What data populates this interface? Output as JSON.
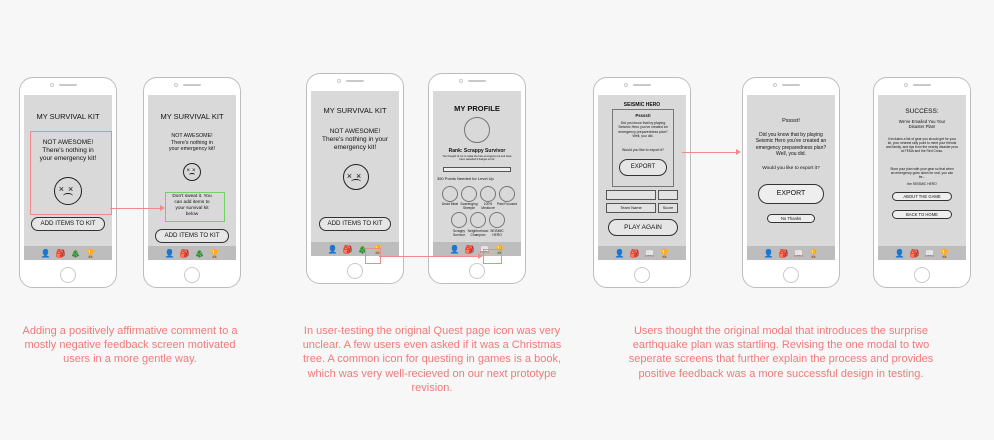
{
  "icons": {
    "person": "person-icon",
    "backpack": "backpack-icon",
    "tree": "tree-icon",
    "book": "book-icon",
    "trophy": "trophy-icon"
  },
  "colors": {
    "highlight_red": "#f08a8a",
    "highlight_green": "#6ed35f",
    "caption": "#ef7a7a",
    "screen": "#d9d9d9"
  },
  "group1": {
    "phone1": {
      "title": "MY SURVIVAL KIT",
      "message": "NOT AWESOME! There's nothing in your emergency kit!",
      "button": "ADD ITEMS TO KIT"
    },
    "phone2": {
      "title": "MY SURVIVAL KIT",
      "message": "NOT AWESOME! There's nothing in your emergency kit!",
      "note": "Don't sweat it. You can add items to your survival kit below",
      "button": "ADD ITEMS TO KIT"
    },
    "caption": "Adding a positively affirmative comment to a mostly negative feedback screen motivated users in a more gentle way."
  },
  "group2": {
    "phone3": {
      "title": "MY SURVIVAL KIT",
      "message": "NOT AWESOME! There's nothing in your emergency kit!",
      "button": "ADD ITEMS TO KIT"
    },
    "phone4": {
      "title": "MY PROFILE",
      "rank": "Rank: Scrappy Survivor",
      "rank_sub": "You thought of not to make the best emergency kit and have been awarded 2 badges so far",
      "points": "350 Points Needed for Level Up",
      "badges": [
        "Dead Meat",
        "Scavenging Sheeple",
        "100% Mediocre",
        "Past Focused",
        "Scrappy Survivor",
        "Neighborhood Champion",
        "SEISMIC HERO"
      ]
    },
    "caption": "In user-testing the original Quest page icon was very unclear. A few users even asked if it was a Christmas tree. A common icon for questing in games is a book, which was very well-recieved on our next prototype revision."
  },
  "group3": {
    "phone5": {
      "header": "SEISMIC HERO",
      "modal_title": "Psssst!",
      "modal_text": "Did you know that by playing Seismic Hero you've created an emergency preparedness plan? Well, you did.",
      "modal_question": "Would you like to export it?",
      "export": "EXPORT",
      "team_name": "Team Name",
      "score": "Score",
      "play_again": "PLAY AGAIN"
    },
    "phone6": {
      "title": "Psssst!",
      "text": "Did you know that by playing Seismic Hero you've created an emergency preparedness plan? Well, you did.",
      "question": "Would you like to export it?",
      "export": "EXPORT",
      "no_thanks": "No Thanks"
    },
    "phone7": {
      "title": "SUCCESS:",
      "subtitle": "We've Emailed You Your Disaster Plan!",
      "para1": "It includes a list of gear you should get for your kit, your nearest rally point to meet your friends and family, and tips from the nearby disaster pros at FEMA and the Red Cross.",
      "para2": "Store your plan with your gear so that when an emergency goes down for real, you can be...",
      "para3": "the SEISMIC HERO",
      "about": "ABOUT THE GAME",
      "back": "BACK TO HOME"
    },
    "caption": "Users thought the original modal that introduces the surprise earthquake plan was startling. Revising the one modal to two seperate screens that further explain the process and provides positive feedback was a more successful design in testing."
  }
}
